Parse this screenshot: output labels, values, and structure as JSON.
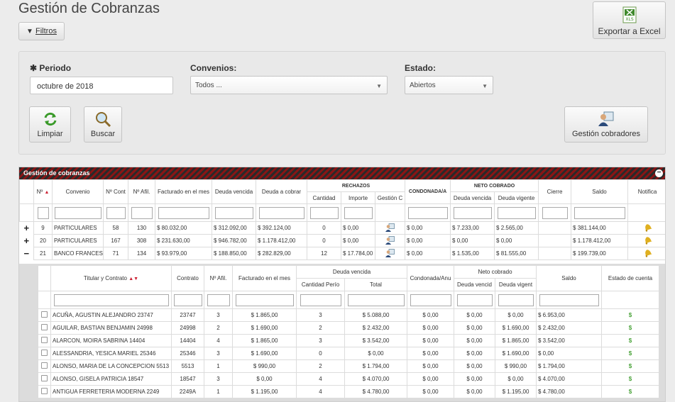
{
  "page": {
    "title": "Gestión de Cobranzas"
  },
  "toolbar": {
    "filtros_label": "Filtros",
    "excel_label": "Exportar a Excel",
    "excel_icon": "excel-xls-icon"
  },
  "filters": {
    "periodo_label": "Periodo",
    "periodo_value": "octubre de 2018",
    "convenios_label": "Convenios:",
    "convenios_value": "Todos ...",
    "estado_label": "Estado:",
    "estado_value": "Abiertos",
    "limpiar_label": "Limpiar",
    "buscar_label": "Buscar",
    "gestion_label": "Gestión cobradores"
  },
  "grid": {
    "title": "Gestión de cobranzas",
    "headers": {
      "num": "Nº",
      "convenio": "Convenio",
      "ncont": "Nº Cont",
      "nafil": "Nº Afil.",
      "facturado": "Facturado en el mes",
      "deuda_vencida": "Deuda vencida",
      "deuda_cobrar": "Deuda a cobrar",
      "rechazos": "RECHAZOS",
      "cantidad": "Cantidad",
      "importe": "Importe",
      "gestion": "Gestión C",
      "condonada": "CONDONADA/A",
      "neto": "NETO COBRADO",
      "neto_vencida": "Deuda vencida",
      "neto_vigente": "Deuda vigente",
      "cierre": "Cierre",
      "saldo": "Saldo",
      "notif": "Notifica"
    },
    "rows": [
      {
        "exp": "+",
        "num": "9",
        "convenio": "PARTICULARES",
        "ncont": "58",
        "nafil": "130",
        "facturado": "$ 80.032,00",
        "vencida": "$ 312.092,00",
        "cobrar": "$ 392.124,00",
        "cantidad": "0",
        "importe": "$ 0,00",
        "condonada": "$ 0,00",
        "neto_venc": "$ 7.233,00",
        "neto_vig": "$ 2.565,00",
        "saldo": "$ 381.144,00"
      },
      {
        "exp": "+",
        "num": "20",
        "convenio": "PARTICULARES",
        "ncont": "167",
        "nafil": "308",
        "facturado": "$ 231.630,00",
        "vencida": "$ 946.782,00",
        "cobrar": "$ 1.178.412,00",
        "cantidad": "0",
        "importe": "$ 0,00",
        "condonada": "$ 0,00",
        "neto_venc": "$ 0,00",
        "neto_vig": "$ 0,00",
        "saldo": "$ 1.178.412,00"
      },
      {
        "exp": "−",
        "num": "21",
        "convenio": "BANCO FRANCES PAGO",
        "ncont": "71",
        "nafil": "134",
        "facturado": "$ 93.979,00",
        "vencida": "$ 188.850,00",
        "cobrar": "$ 282.829,00",
        "cantidad": "12",
        "importe": "$ 17.784,00",
        "condonada": "$ 0,00",
        "neto_venc": "$ 1.535,00",
        "neto_vig": "$ 81.555,00",
        "saldo": "$ 199.739,00"
      }
    ]
  },
  "detail": {
    "headers": {
      "titular": "Titular y Contrato",
      "contrato": "Contrato",
      "nafil": "Nº Afil.",
      "facturado": "Facturado en el mes",
      "deuda_vencida": "Deuda vencida",
      "cantidad": "Cantidad Perío",
      "total": "Total",
      "condonada": "Condonada/Anu",
      "neto": "Neto cobrado",
      "neto_vencida": "Deuda vencid",
      "neto_vigente": "Deuda vigent",
      "saldo": "Saldo",
      "estado": "Estado de cuenta"
    },
    "rows": [
      {
        "titular": "ACUÑA, AGUSTIN ALEJANDRO 23747",
        "contrato": "23747",
        "nafil": "3",
        "facturado": "$ 1.865,00",
        "cantidad": "3",
        "total": "$ 5.088,00",
        "condonada": "$ 0,00",
        "neto_venc": "$ 0,00",
        "neto_vig": "$ 0,00",
        "saldo": "$ 6.953,00"
      },
      {
        "titular": "AGUILAR, BASTIAN BENJAMIN 24998",
        "contrato": "24998",
        "nafil": "2",
        "facturado": "$ 1.690,00",
        "cantidad": "2",
        "total": "$ 2.432,00",
        "condonada": "$ 0,00",
        "neto_venc": "$ 0,00",
        "neto_vig": "$ 1.690,00",
        "saldo": "$ 2.432,00"
      },
      {
        "titular": "ALARCON, MOIRA SABRINA 14404",
        "contrato": "14404",
        "nafil": "4",
        "facturado": "$ 1.865,00",
        "cantidad": "3",
        "total": "$ 3.542,00",
        "condonada": "$ 0,00",
        "neto_venc": "$ 0,00",
        "neto_vig": "$ 1.865,00",
        "saldo": "$ 3.542,00"
      },
      {
        "titular": "ALESSANDRIA, YESICA MARIEL 25346",
        "contrato": "25346",
        "nafil": "3",
        "facturado": "$ 1.690,00",
        "cantidad": "0",
        "total": "$ 0,00",
        "condonada": "$ 0,00",
        "neto_venc": "$ 0,00",
        "neto_vig": "$ 1.690,00",
        "saldo": "$ 0,00"
      },
      {
        "titular": "ALONSO,  MARIA DE LA CONCEPCION 5513",
        "contrato": "5513",
        "nafil": "1",
        "facturado": "$ 990,00",
        "cantidad": "2",
        "total": "$ 1.794,00",
        "condonada": "$ 0,00",
        "neto_venc": "$ 0,00",
        "neto_vig": "$ 990,00",
        "saldo": "$ 1.794,00"
      },
      {
        "titular": "ALONSO, GISELA PATRICIA 18547",
        "contrato": "18547",
        "nafil": "3",
        "facturado": "$ 0,00",
        "cantidad": "4",
        "total": "$ 4.070,00",
        "condonada": "$ 0,00",
        "neto_venc": "$ 0,00",
        "neto_vig": "$ 0,00",
        "saldo": "$ 4.070,00"
      },
      {
        "titular": "ANTIGUA FERRETERIA MODERNA 2249",
        "contrato": "2249A",
        "nafil": "1",
        "facturado": "$ 1.195,00",
        "cantidad": "4",
        "total": "$ 4.780,00",
        "condonada": "$ 0,00",
        "neto_venc": "$ 0,00",
        "neto_vig": "$ 1.195,00",
        "saldo": "$ 4.780,00"
      }
    ]
  },
  "colors": {
    "accent_dark": "#2a2a2a",
    "accent_red": "#8a1515",
    "money_green": "#4aa33a"
  }
}
